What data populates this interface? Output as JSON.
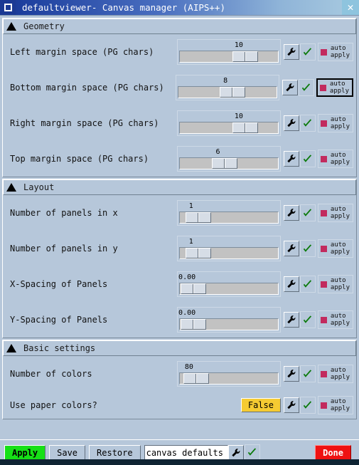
{
  "window": {
    "title": "defaultviewer- Canvas manager (AIPS++)",
    "icon": "window-square-icon",
    "close_label": "✕"
  },
  "sections": [
    {
      "id": "geometry",
      "title": "Geometry",
      "rows": [
        {
          "label": "Left margin space (PG chars)",
          "value": "10",
          "handle_pct": 54,
          "auto_label_1": "auto",
          "auto_label_2": "apply",
          "focused": false
        },
        {
          "label": "Bottom margin space (PG chars)",
          "value": "8",
          "handle_pct": 42,
          "auto_label_1": "auto",
          "auto_label_2": "apply",
          "focused": true
        },
        {
          "label": "Right margin space (PG chars)",
          "value": "10",
          "handle_pct": 54,
          "auto_label_1": "auto",
          "auto_label_2": "apply",
          "focused": false
        },
        {
          "label": "Top margin space (PG chars)",
          "value": "6",
          "handle_pct": 33,
          "auto_label_1": "auto",
          "auto_label_2": "apply",
          "focused": false
        }
      ]
    },
    {
      "id": "layout",
      "title": "Layout",
      "rows": [
        {
          "label": "Number of panels in x",
          "value": "1",
          "handle_pct": 6,
          "auto_label_1": "auto",
          "auto_label_2": "apply",
          "focused": false
        },
        {
          "label": "Number of panels in y",
          "value": "1",
          "handle_pct": 6,
          "auto_label_1": "auto",
          "auto_label_2": "apply",
          "focused": false
        },
        {
          "label": "X-Spacing of Panels",
          "value": "0.00",
          "handle_pct": 1,
          "auto_label_1": "auto",
          "auto_label_2": "apply",
          "focused": false
        },
        {
          "label": "Y-Spacing of Panels",
          "value": "0.00",
          "handle_pct": 1,
          "auto_label_1": "auto",
          "auto_label_2": "apply",
          "focused": false
        }
      ]
    },
    {
      "id": "basic-settings",
      "title": "Basic settings",
      "rows": [
        {
          "label": "Number of colors",
          "value": "80",
          "handle_pct": 4,
          "auto_label_1": "auto",
          "auto_label_2": "apply",
          "focused": false
        }
      ],
      "button_rows": [
        {
          "label": "Use paper colors?",
          "value": "False",
          "auto_label_1": "auto",
          "auto_label_2": "apply",
          "focused": false
        }
      ]
    }
  ],
  "bottom_bar": {
    "apply_label": "Apply",
    "save_label": "Save",
    "restore_label": "Restore",
    "entry_value": "canvas defaults",
    "entry_placeholder": "canvas defaults",
    "done_label": "Done"
  },
  "colors": {
    "background": "#b6c7da",
    "title_dark": "#17348c",
    "apply_green": "#16e016",
    "done_red": "#ef1111",
    "value_yellow": "#f5cb32",
    "led_crimson": "#c22a5e",
    "check_green": "#1a7a1a"
  }
}
